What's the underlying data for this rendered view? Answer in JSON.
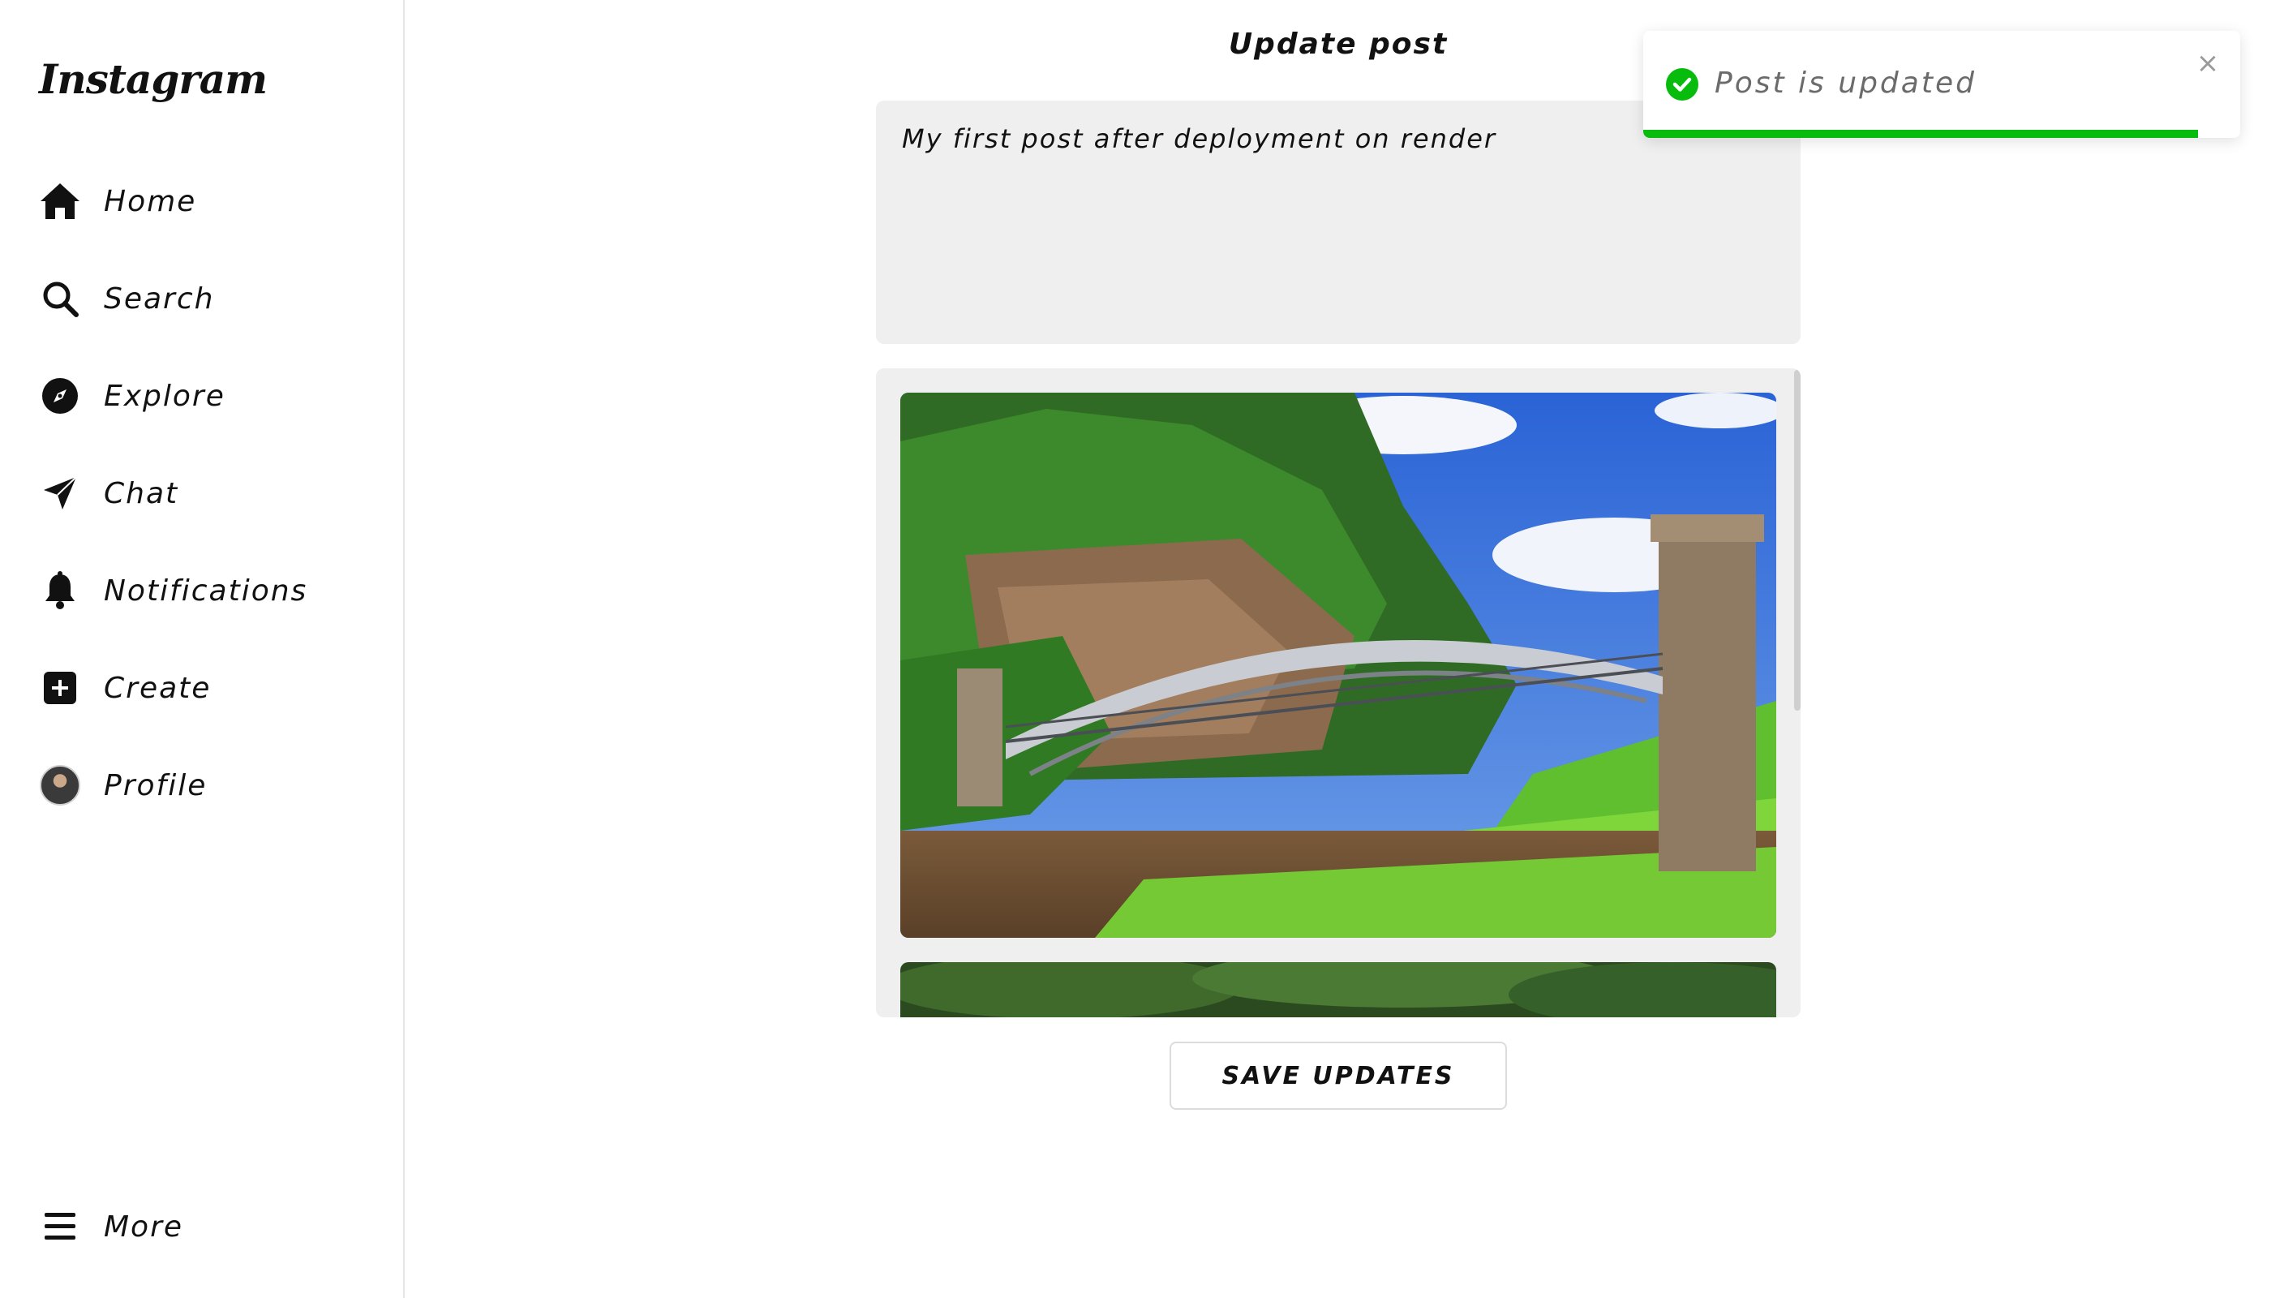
{
  "brand": {
    "logo_text": "Instagram"
  },
  "sidebar": {
    "items": [
      {
        "label": "Home",
        "icon": "home-icon"
      },
      {
        "label": "Search",
        "icon": "search-icon"
      },
      {
        "label": "Explore",
        "icon": "compass-icon"
      },
      {
        "label": "Chat",
        "icon": "send-icon"
      },
      {
        "label": "Notifications",
        "icon": "bell-icon"
      },
      {
        "label": "Create",
        "icon": "plus-square-icon"
      },
      {
        "label": "Profile",
        "icon": "avatar"
      }
    ],
    "more": {
      "label": "More",
      "icon": "menu-icon"
    }
  },
  "main": {
    "title": "Update post",
    "caption": "My first post after deployment on render",
    "save_label": "SAVE UPDATES"
  },
  "toast": {
    "message": "Post is updated",
    "status": "success",
    "progress_fraction": 0.93,
    "close_glyph": "×"
  },
  "colors": {
    "success": "#07bc0c",
    "panel_bg": "#efefef",
    "text": "#111111"
  }
}
